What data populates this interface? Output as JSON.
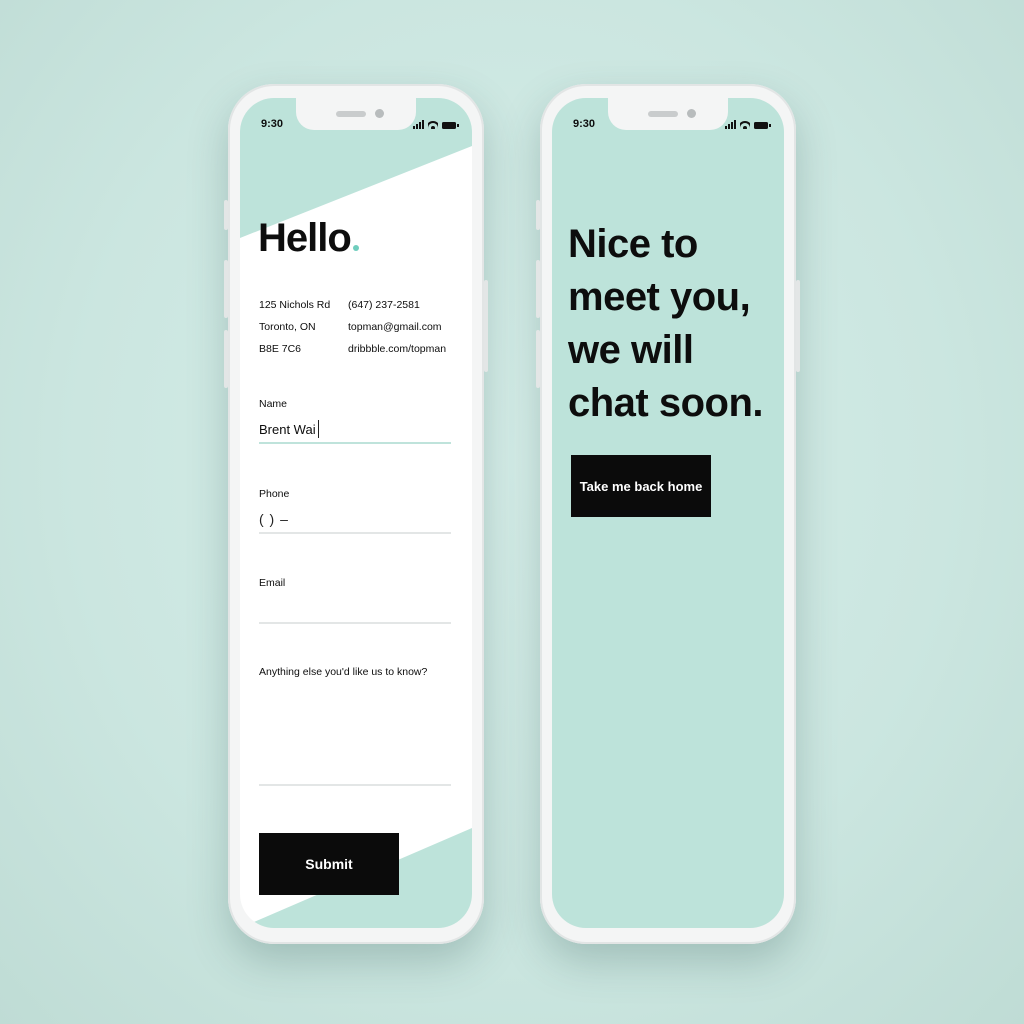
{
  "colors": {
    "background": "#cde8e2",
    "mint": "#bde3da",
    "accent_dot": "#6fcdbd",
    "button": "#0b0b0b"
  },
  "left_phone": {
    "status_time": "9:30",
    "heading": "Hello",
    "contact": {
      "address_line1": "125 Nichols Rd",
      "address_line2": "Toronto, ON",
      "address_line3": "B8E 7C6",
      "phone": "(647) 237-2581",
      "email": "topman@gmail.com",
      "website": "dribbble.com/topman"
    },
    "form": {
      "name_label": "Name",
      "name_value": "Brent Wai",
      "phone_label": "Phone",
      "phone_value": "(     )     –",
      "email_label": "Email",
      "email_value": "",
      "message_label": "Anything else you'd like us to know?",
      "message_value": "",
      "submit_label": "Submit"
    }
  },
  "right_phone": {
    "status_time": "9:30",
    "message_lines": [
      "Nice to",
      "meet you,",
      "we will",
      "chat soon."
    ],
    "home_button_label": "Take me back home"
  },
  "icons": [
    "signal-icon",
    "wifi-icon",
    "battery-icon"
  ]
}
